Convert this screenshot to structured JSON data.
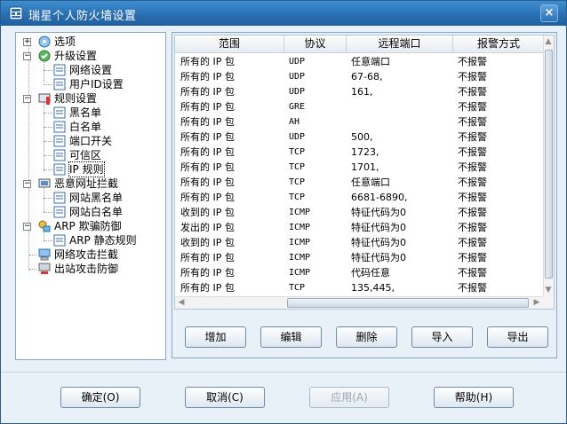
{
  "window": {
    "title": "瑞星个人防火墙设置"
  },
  "tree": {
    "options": "选项",
    "upgrade": "升级设置",
    "network_settings": "网络设置",
    "user_id_settings": "用户ID设置",
    "rules": "规则设置",
    "blacklist": "黑名单",
    "whitelist": "白名单",
    "port_switch": "端口开关",
    "trusted_zone": "可信区",
    "ip_rules": "IP 规则",
    "malicious_url": "恶意网址拦截",
    "site_blacklist": "网站黑名单",
    "site_whitelist": "网站白名单",
    "arp_defense": "ARP 欺骗防御",
    "arp_static": "ARP 静态规则",
    "net_attack": "网络攻击拦截",
    "outbound_attack": "出站攻击防御"
  },
  "table": {
    "headers": [
      "范围",
      "协议",
      "远程端口",
      "报警方式"
    ],
    "rows": [
      [
        "所有的 IP 包",
        "UDP",
        "任意端口",
        "不报警"
      ],
      [
        "所有的 IP 包",
        "UDP",
        "67-68,",
        "不报警"
      ],
      [
        "所有的 IP 包",
        "UDP",
        "161,",
        "不报警"
      ],
      [
        "所有的 IP 包",
        "GRE",
        "",
        "不报警"
      ],
      [
        "所有的 IP 包",
        "AH",
        "",
        "不报警"
      ],
      [
        "所有的 IP 包",
        "UDP",
        "500,",
        "不报警"
      ],
      [
        "所有的 IP 包",
        "TCP",
        "1723,",
        "不报警"
      ],
      [
        "所有的 IP 包",
        "TCP",
        "1701,",
        "不报警"
      ],
      [
        "所有的 IP 包",
        "TCP",
        "任意端口",
        "不报警"
      ],
      [
        "所有的 IP 包",
        "TCP",
        "6681-6890,",
        "不报警"
      ],
      [
        "收到的 IP 包",
        "ICMP",
        "特征代码为0",
        "不报警"
      ],
      [
        "发出的 IP 包",
        "ICMP",
        "特征代码为0",
        "不报警"
      ],
      [
        "收到的 IP 包",
        "ICMP",
        "特征代码为0",
        "不报警"
      ],
      [
        "所有的 IP 包",
        "ICMP",
        "特征代码为0",
        "不报警"
      ],
      [
        "所有的 IP 包",
        "ICMP",
        "代码任意",
        "不报警"
      ],
      [
        "所有的 IP 包",
        "TCP",
        "135,445,",
        "不报警"
      ]
    ]
  },
  "actions": {
    "add": "增加",
    "edit": "编辑",
    "delete": "删除",
    "import": "导入",
    "export": "导出"
  },
  "footer": {
    "ok": "确定(O)",
    "cancel": "取消(C)",
    "apply": "应用(A)",
    "help": "帮助(H)"
  },
  "colors": {
    "title_bar": "#2a6fb2",
    "window_bg": "#e8f1f8"
  }
}
